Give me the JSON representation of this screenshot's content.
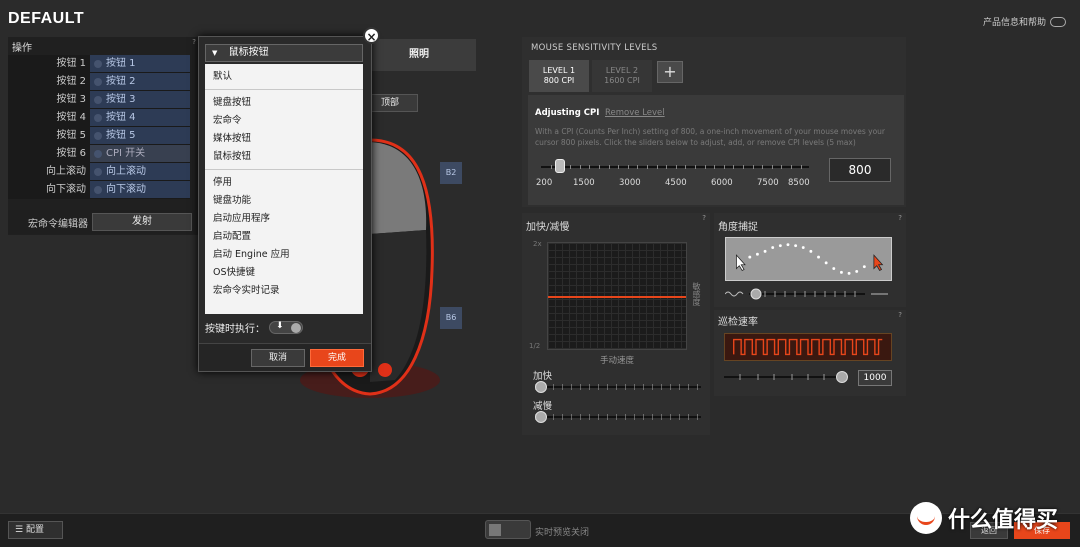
{
  "app": {
    "title": "DEFAULT",
    "product_help": "产品信息和帮助"
  },
  "left_panel": {
    "heading": "操作",
    "help": "?",
    "rows": [
      {
        "label": "按钮 1",
        "value": "按钮 1"
      },
      {
        "label": "按钮 2",
        "value": "按钮 2"
      },
      {
        "label": "按钮 3",
        "value": "按钮 3"
      },
      {
        "label": "按钮 4",
        "value": "按钮 4"
      },
      {
        "label": "按钮 5",
        "value": "按钮 5"
      },
      {
        "label": "按钮 6",
        "value": "CPI 开关"
      },
      {
        "label": "向上滚动",
        "value": "向上滚动"
      },
      {
        "label": "向下滚动",
        "value": "向下滚动"
      }
    ],
    "macro_label": "宏命令编辑器",
    "macro_button": "发射"
  },
  "mouse_area": {
    "lighting_tab": "照明",
    "top_button": "顶部",
    "badge_b2": "B2",
    "badge_b6": "B6"
  },
  "popup": {
    "header": "鼠标按钮",
    "menu_group1": [
      "默认"
    ],
    "menu_group2": [
      "键盘按钮",
      "宏命令",
      "媒体按钮",
      "鼠标按钮"
    ],
    "menu_group3": [
      "停用",
      "键盘功能",
      "启动应用程序",
      "启动配置",
      "启动 Engine 应用",
      "OS快捷键",
      "宏命令实时记录"
    ],
    "exec_label": "按键时执行：",
    "cancel": "取消",
    "done": "完成"
  },
  "sensitivity": {
    "title": "MOUSE SENSITIVITY LEVELS",
    "level1": {
      "name": "LEVEL 1",
      "cpi": "800 CPI"
    },
    "level2": {
      "name": "LEVEL 2",
      "cpi": "1600 CPI"
    },
    "add": "+",
    "adjusting": "Adjusting CPI",
    "remove": "Remove Level",
    "description": "With a CPI (Counts Per Inch) setting of 800, a one-inch movement of your mouse moves your cursor 800 pixels. Click the sliders below to adjust, add, or remove CPI levels (5 max)",
    "ticks": [
      "200",
      "1500",
      "3000",
      "4500",
      "6000",
      "7500",
      "8500"
    ],
    "value": "800"
  },
  "accel": {
    "title": "加快/减慢",
    "help": "?",
    "y_top": "2x",
    "y_bottom": "1/2",
    "y_label": "敏感度",
    "x_label": "手动速度",
    "accel_label": "加快",
    "decel_label": "减慢"
  },
  "angle": {
    "title": "角度捕捉",
    "help": "?"
  },
  "polling": {
    "title": "巡检速率",
    "help": "?",
    "value": "1000"
  },
  "bottom": {
    "config": "配置",
    "preview": "实时预览关闭",
    "restore": "返回",
    "save": "保存"
  },
  "watermark": "什么值得买",
  "colors": {
    "accent": "#e8461b",
    "button_blue": "#2d3b55"
  }
}
